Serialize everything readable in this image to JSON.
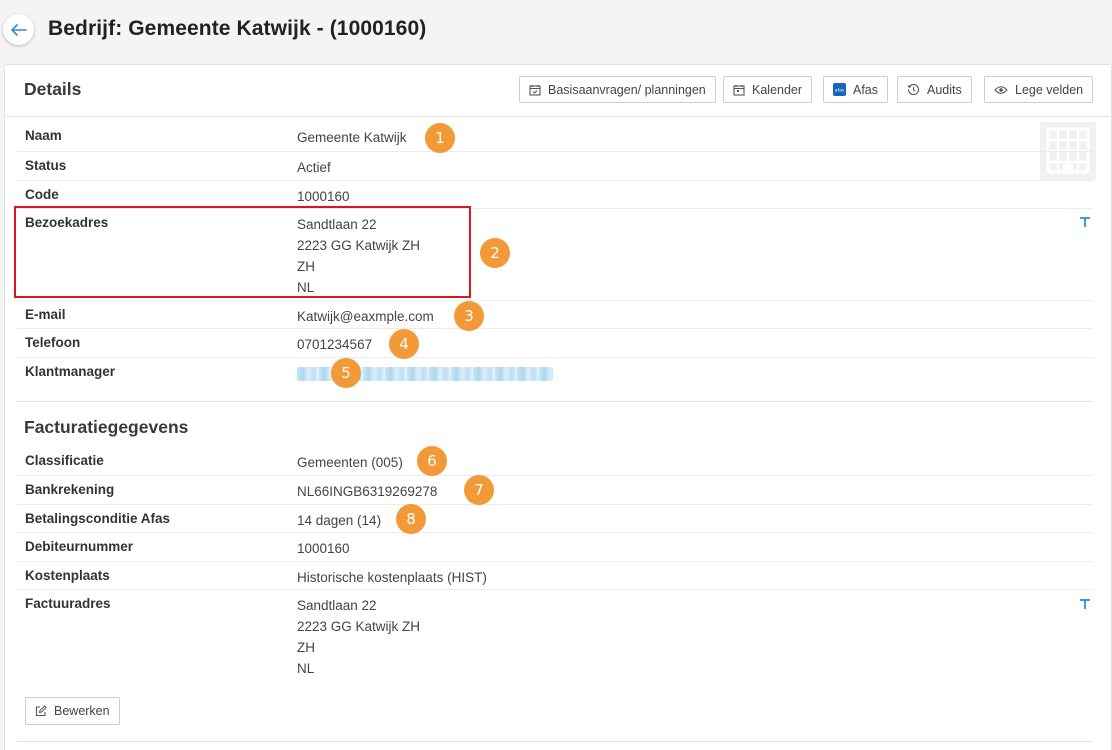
{
  "header": {
    "title": "Bedrijf: Gemeente Katwijk - (1000160)"
  },
  "details": {
    "title": "Details",
    "toolbar": {
      "basis_label": "Basisaanvragen/ planningen",
      "calendar_label": "Kalender",
      "afas_label": "Afas",
      "afas_logo_text": "afas",
      "audits_label": "Audits",
      "empty_fields_label": "Lege velden"
    },
    "fields": {
      "naam": {
        "label": "Naam",
        "value": "Gemeente Katwijk"
      },
      "status": {
        "label": "Status",
        "value": "Actief"
      },
      "code": {
        "label": "Code",
        "value": "1000160"
      },
      "bezoekadres": {
        "label": "Bezoekadres",
        "lines": [
          "Sandtlaan 22",
          "2223 GG Katwijk ZH",
          "ZH",
          "NL"
        ]
      },
      "email": {
        "label": "E-mail",
        "value": "Katwijk@eaxmple.com"
      },
      "telefoon": {
        "label": "Telefoon",
        "value": "0701234567"
      },
      "klantmanager": {
        "label": "Klantmanager"
      }
    }
  },
  "billing": {
    "title": "Facturatiegegevens",
    "fields": {
      "classificatie": {
        "label": "Classificatie",
        "value": "Gemeenten (005)"
      },
      "bankrekening": {
        "label": "Bankrekening",
        "value": "NL66INGB6319269278"
      },
      "betalingsconditie": {
        "label": "Betalingsconditie Afas",
        "value": "14 dagen (14)"
      },
      "debiteurnummer": {
        "label": "Debiteurnummer",
        "value": "1000160"
      },
      "kostenplaats": {
        "label": "Kostenplaats",
        "value": "Historische kostenplaats (HIST)"
      },
      "factuuradres": {
        "label": "Factuuradres",
        "lines": [
          "Sandtlaan 22",
          "2223 GG Katwijk ZH",
          "ZH",
          "NL"
        ]
      }
    },
    "edit_label": "Bewerken"
  },
  "annotations": [
    "1",
    "2",
    "3",
    "4",
    "5",
    "6",
    "7",
    "8"
  ],
  "colors": {
    "badge": "#f39a38",
    "highlight": "#d9161e",
    "accent": "#2a8fd6"
  }
}
